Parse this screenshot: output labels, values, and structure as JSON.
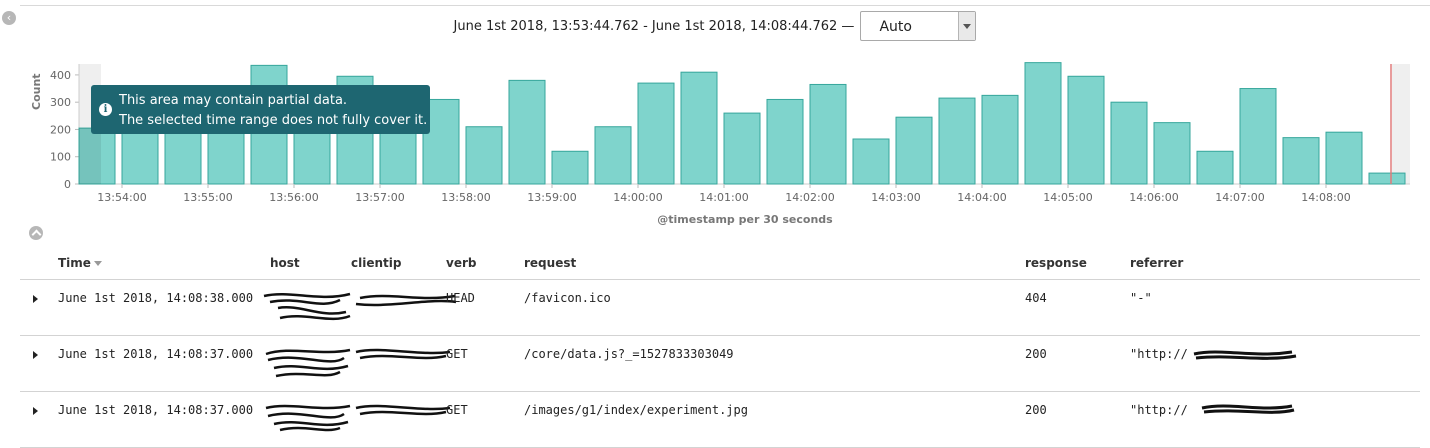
{
  "header": {
    "time_range": "June 1st 2018, 13:53:44.762 - June 1st 2018, 14:08:44.762 —",
    "interval": "Auto"
  },
  "tooltip": {
    "line1": "This area may contain partial data.",
    "line2": "The selected time range does not fully cover it."
  },
  "chart_data": {
    "type": "bar",
    "ylabel": "Count",
    "xlabel": "@timestamp per 30 seconds",
    "ylim": [
      0,
      440
    ],
    "y_ticks": [
      0,
      100,
      200,
      300,
      400
    ],
    "x_tick_labels": [
      "13:54:00",
      "13:55:00",
      "13:56:00",
      "13:57:00",
      "13:58:00",
      "13:59:00",
      "14:00:00",
      "14:01:00",
      "14:02:00",
      "14:03:00",
      "14:04:00",
      "14:05:00",
      "14:06:00",
      "14:07:00",
      "14:08:00"
    ],
    "values": [
      205,
      215,
      210,
      205,
      435,
      260,
      395,
      275,
      310,
      210,
      380,
      120,
      210,
      370,
      410,
      260,
      310,
      365,
      165,
      245,
      315,
      325,
      445,
      395,
      300,
      225,
      120,
      350,
      170,
      190,
      40
    ],
    "bar_color": "#7fd4cc",
    "bar_edge_color": "#36a69b",
    "partial_area_color": "#efefef",
    "now_marker_color": "#e07a7a"
  },
  "table": {
    "headers": {
      "time": "Time",
      "host": "host",
      "clientip": "clientip",
      "verb": "verb",
      "request": "request",
      "response": "response",
      "referrer": "referrer"
    },
    "rows": [
      {
        "time": "June 1st 2018, 14:08:38.000",
        "verb": "HEAD",
        "request": "/favicon.ico",
        "response": "404",
        "referrer": "\"-\""
      },
      {
        "time": "June 1st 2018, 14:08:37.000",
        "verb": "GET",
        "request": "/core/data.js?_=1527833303049",
        "response": "200",
        "referrer": "\"http://"
      },
      {
        "time": "June 1st 2018, 14:08:37.000",
        "verb": "GET",
        "request": "/images/g1/index/experiment.jpg",
        "response": "200",
        "referrer": "\"http://"
      }
    ]
  }
}
